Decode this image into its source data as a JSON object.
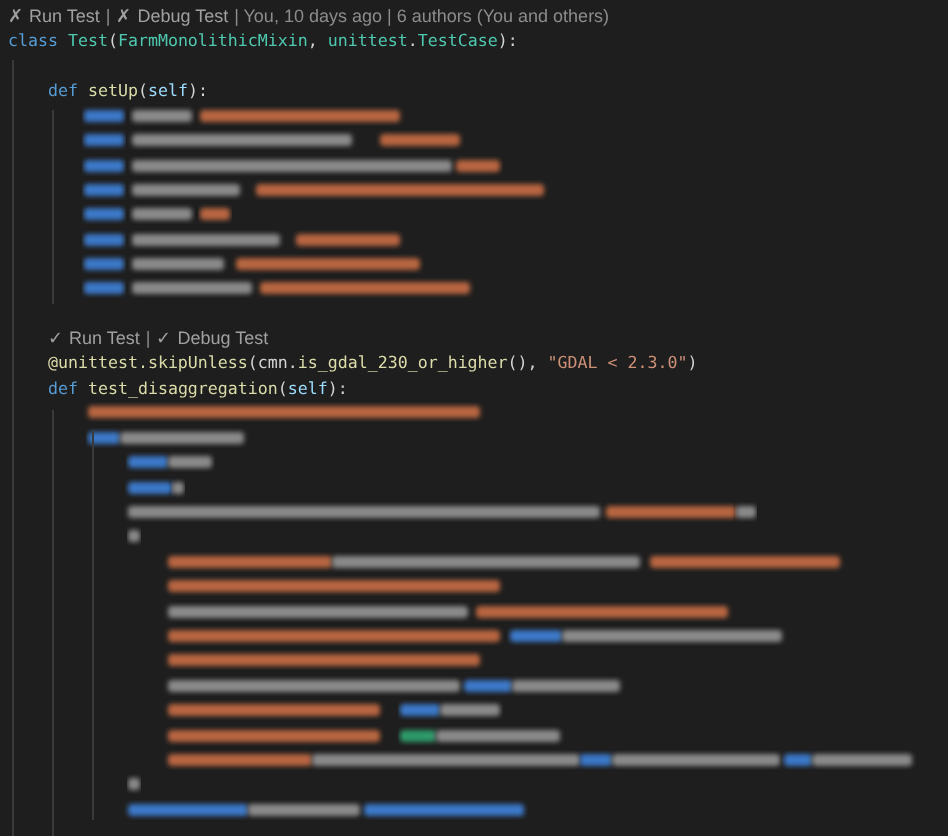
{
  "editor": {
    "lines": [
      {
        "kind": "lens",
        "items": [
          {
            "kind": "action",
            "text": "✗ Run Test"
          },
          {
            "kind": "info",
            "text": "|"
          },
          {
            "kind": "action",
            "text": "✗ Debug Test"
          },
          {
            "kind": "info",
            "text": "| You, 10 days ago | 6 authors (You and others)"
          }
        ]
      },
      {
        "kind": "code",
        "tokens": [
          {
            "kind": "keyword",
            "text": "class "
          },
          {
            "kind": "class",
            "text": "Test"
          },
          {
            "kind": "plain",
            "text": "("
          },
          {
            "kind": "class",
            "text": "FarmMonolithicMixin"
          },
          {
            "kind": "plain",
            "text": ", "
          },
          {
            "kind": "class",
            "text": "unittest"
          },
          {
            "kind": "plain",
            "text": "."
          },
          {
            "kind": "class",
            "text": "TestCase"
          },
          {
            "kind": "plain",
            "text": "):"
          }
        ],
        "children": [
          {
            "kind": "empty"
          },
          {
            "kind": "code",
            "tokens": [
              {
                "kind": "keyword",
                "text": "def "
              },
              {
                "kind": "function",
                "text": "setUp"
              },
              {
                "kind": "plain",
                "text": "("
              },
              {
                "kind": "param",
                "text": "self"
              },
              {
                "kind": "plain",
                "text": "):"
              }
            ],
            "children": [
              {
                "kind": "blur"
              },
              {
                "kind": "blur"
              },
              {
                "kind": "blur"
              },
              {
                "kind": "blur"
              },
              {
                "kind": "blur"
              },
              {
                "kind": "blur"
              },
              {
                "kind": "blur"
              },
              {
                "kind": "blur"
              }
            ]
          },
          {
            "kind": "empty"
          },
          {
            "kind": "lens",
            "items": [
              {
                "kind": "action",
                "text": "✓ Run Test"
              },
              {
                "kind": "info",
                "text": "|"
              },
              {
                "kind": "action",
                "text": "✓ Debug Test"
              }
            ]
          },
          {
            "kind": "code",
            "tokens": [
              {
                "kind": "function",
                "text": "@unittest.skipUnless"
              },
              {
                "kind": "plain",
                "text": "(cmn."
              },
              {
                "kind": "function",
                "text": "is_gdal_230_or_higher"
              },
              {
                "kind": "plain",
                "text": "(), "
              },
              {
                "kind": "string",
                "text": "\"GDAL < 2.3.0\""
              },
              {
                "kind": "plain",
                "text": ")"
              }
            ]
          },
          {
            "kind": "code",
            "tokens": [
              {
                "kind": "keyword",
                "text": "def "
              },
              {
                "kind": "function",
                "text": "test_disaggregation"
              },
              {
                "kind": "plain",
                "text": "("
              },
              {
                "kind": "param",
                "text": "self"
              },
              {
                "kind": "plain",
                "text": "):"
              }
            ],
            "children": [
              {
                "kind": "blur"
              },
              {
                "kind": "blur"
              },
              {
                "kind": "blur"
              },
              {
                "kind": "blur"
              },
              {
                "kind": "blur"
              },
              {
                "kind": "blur"
              },
              {
                "kind": "blur"
              },
              {
                "kind": "blur"
              },
              {
                "kind": "blur"
              },
              {
                "kind": "blur"
              },
              {
                "kind": "blur"
              },
              {
                "kind": "blur"
              },
              {
                "kind": "blur"
              },
              {
                "kind": "blur"
              },
              {
                "kind": "blur"
              },
              {
                "kind": "blur"
              },
              {
                "kind": "blur"
              }
            ]
          }
        ]
      }
    ]
  }
}
